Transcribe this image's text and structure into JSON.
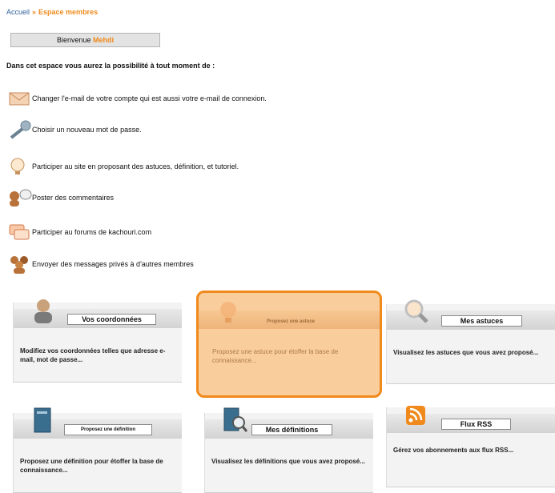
{
  "breadcrumb": {
    "home": "Accueil",
    "separator": "»",
    "current": "Espace membres"
  },
  "welcome": {
    "prefix": "Bienvenue",
    "username": "Mehdi"
  },
  "intro": "Dans cet espace vous aurez la possibilité à tout moment de :",
  "features": [
    {
      "icon": "envelope-icon",
      "text": "Changer l'e-mail de votre compte qui est aussi votre e-mail de connexion."
    },
    {
      "icon": "key-icon",
      "text": "Choisir un nouveau mot de passe."
    },
    {
      "icon": "lightbulb-icon",
      "text": "Participer au site en proposant des astuces, définition, et tutoriel."
    },
    {
      "icon": "comment-user-icon",
      "text": "Poster des commentaires"
    },
    {
      "icon": "forum-icon",
      "text": "Participer au forums de kachouri.com"
    },
    {
      "icon": "group-icon",
      "text": "Envoyer des messages privés à d'autres membres"
    }
  ],
  "cards": [
    {
      "icon": "user-icon",
      "title": "Vos coordonnées",
      "desc": "Modifiez vos coordonnées telles que adresse e-mail, mot de passe..."
    },
    {
      "icon": "lightbulb-icon",
      "title": "Proposez une astuce",
      "desc": "Proposez une astuce pour étoffer la base de connaissance..."
    },
    {
      "icon": "magnifier-icon",
      "title": "Mes astuces",
      "desc": "Visualisez les astuces que vous avez proposé..."
    },
    {
      "icon": "book-icon",
      "title": "Proposez une définition",
      "desc": "Proposez une définition pour étoffer la base de connaissance..."
    },
    {
      "icon": "book-magnifier-icon",
      "title": "Mes définitions",
      "desc": "Visualisez les définitions que vous avez proposé..."
    },
    {
      "icon": "rss-icon",
      "title": "Flux RSS",
      "desc": "Gérez vos abonnements aux flux RSS..."
    }
  ],
  "colors": {
    "accent": "#f08a1c",
    "link": "#2d5f9a",
    "highlight_bg": "#f9cd9c"
  }
}
